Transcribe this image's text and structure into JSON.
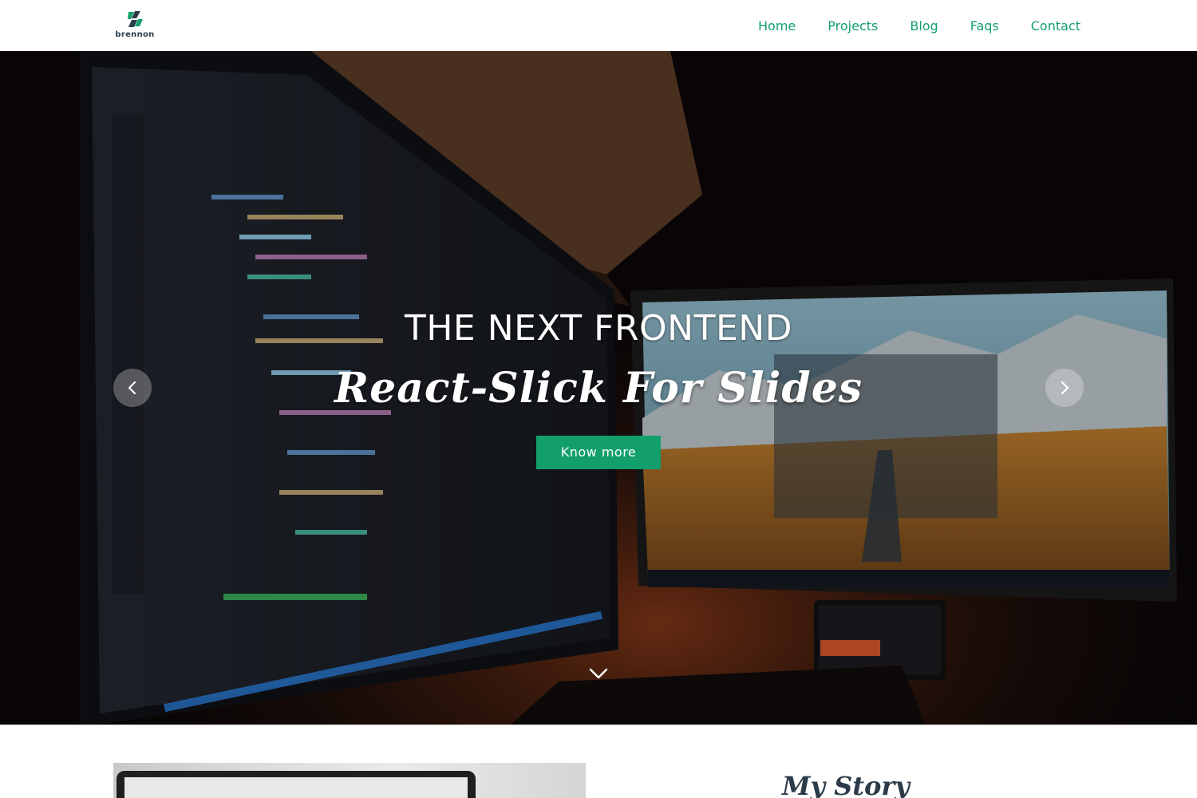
{
  "header": {
    "logo_text": "brennon",
    "nav": [
      "Home",
      "Projects",
      "Blog",
      "Faqs",
      "Contact"
    ]
  },
  "hero": {
    "title": "THE NEXT FRONTEND",
    "subtitle": "React-Slick For Slides",
    "button_label": "Know more"
  },
  "story": {
    "title": "My Story"
  },
  "colors": {
    "accent": "#129f6c",
    "dark_text": "#2b3b4a"
  },
  "icons": {
    "prev": "chevron-left-icon",
    "next": "chevron-right-icon",
    "scroll": "chevron-down-icon"
  }
}
